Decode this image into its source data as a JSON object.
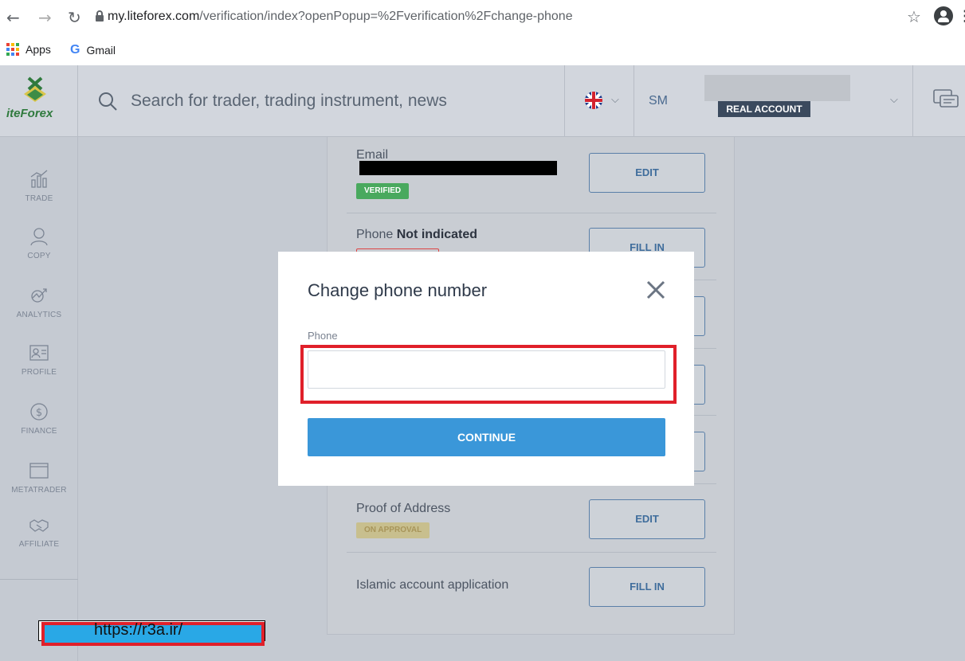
{
  "browser": {
    "url_host": "my.liteforex.com",
    "url_path": "/verification/index?openPopup=%2Fverification%2Fchange-phone",
    "bookmarks": [
      "Apps",
      "Gmail"
    ]
  },
  "header": {
    "logo_text": "iteForex",
    "search_placeholder": "Search for trader, trading instrument, news",
    "user_initials": "SM",
    "account_type": "REAL ACCOUNT"
  },
  "sidebar": {
    "items": [
      {
        "label": "TRADE",
        "icon": "chart-icon"
      },
      {
        "label": "COPY",
        "icon": "trader-icon"
      },
      {
        "label": "ANALYTICS",
        "icon": "analytics-icon"
      },
      {
        "label": "PROFILE",
        "icon": "id-card-icon"
      },
      {
        "label": "FINANCE",
        "icon": "dollar-icon"
      },
      {
        "label": "METATRADER",
        "icon": "window-icon"
      },
      {
        "label": "AFFILIATE",
        "icon": "handshake-icon"
      }
    ]
  },
  "verification": {
    "rows": [
      {
        "title": "Email",
        "badge": "VERIFIED",
        "button": "EDIT"
      },
      {
        "title": "Phone",
        "value": "Not indicated",
        "button": "FILL IN"
      },
      {
        "title": "Proof of Address",
        "badge": "ON APPROVAL",
        "button": "EDIT"
      },
      {
        "title": "Islamic account application",
        "button": "FILL IN"
      }
    ]
  },
  "modal": {
    "title": "Change phone number",
    "field_label": "Phone",
    "field_value": "",
    "button": "CONTINUE"
  },
  "watermark": {
    "text": "https://r3a.ir/"
  },
  "colors": {
    "accent": "#3a97d9",
    "verified": "#49a95e",
    "highlight": "#e0202a"
  }
}
